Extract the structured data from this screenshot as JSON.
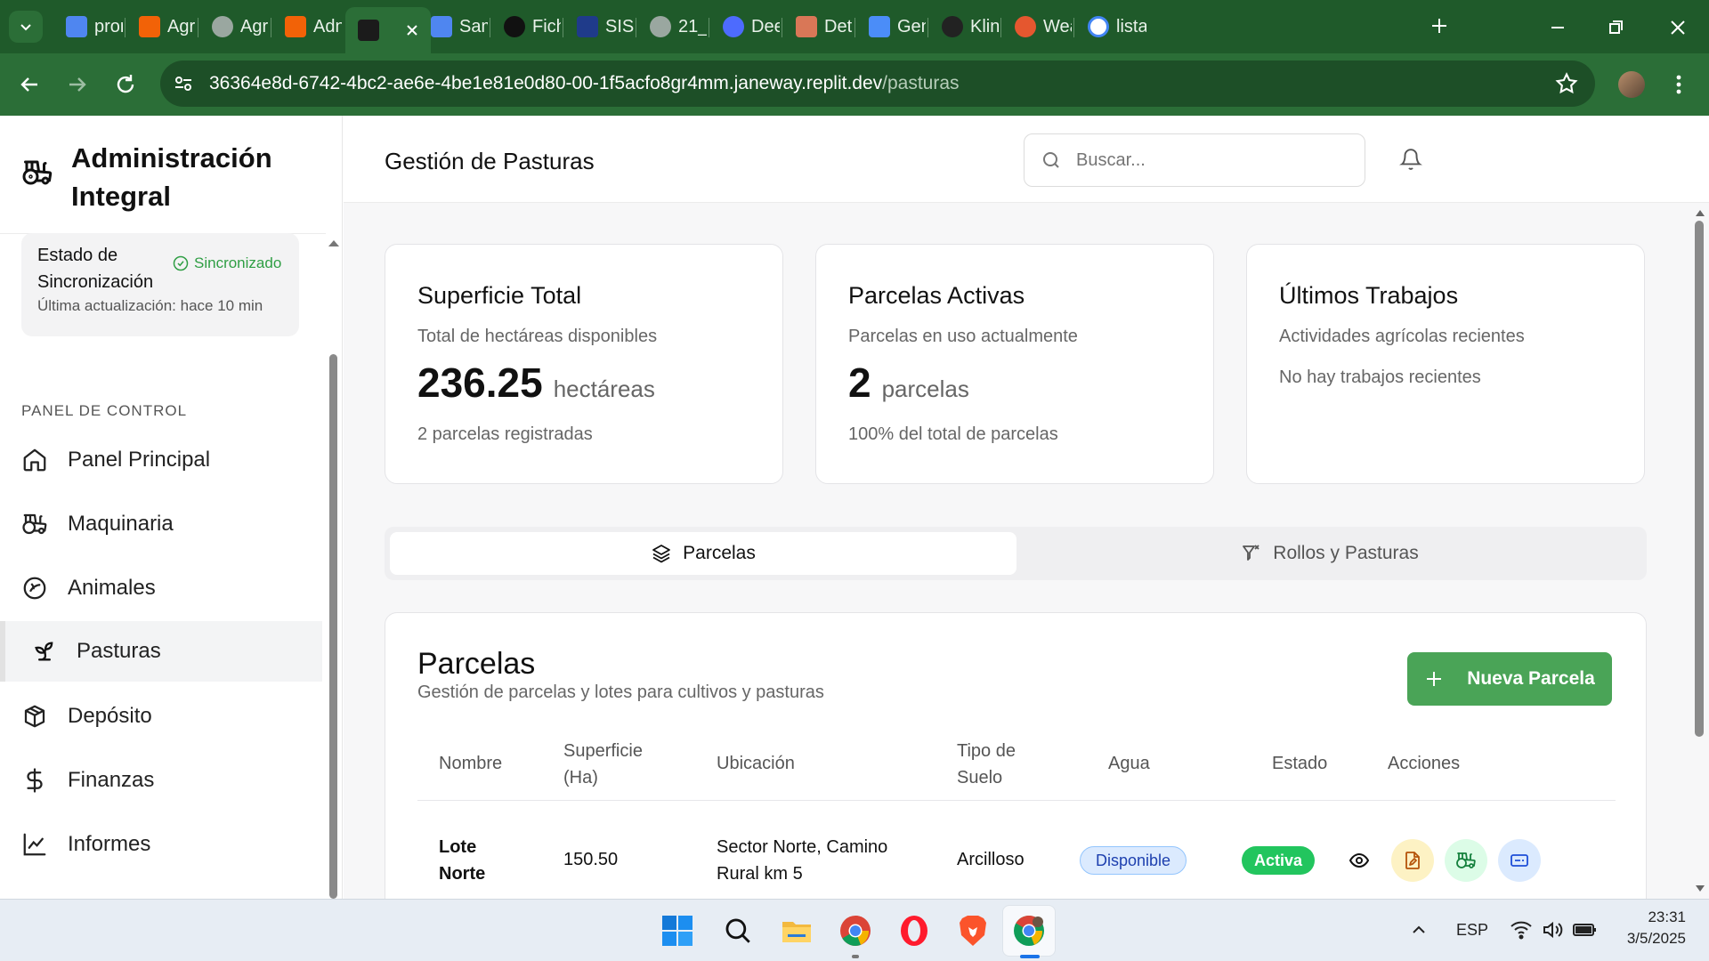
{
  "browser": {
    "tabs": [
      {
        "label": "pror",
        "icon": "docs-icon",
        "color": "#4f86f0"
      },
      {
        "label": "Agri",
        "icon": "replit-icon",
        "color": "#f26207"
      },
      {
        "label": "Agri",
        "icon": "globe-icon",
        "color": "#9aa7a0"
      },
      {
        "label": "Adn",
        "icon": "replit-icon",
        "color": "#f26207"
      },
      {
        "label": "",
        "icon": "terminal-icon",
        "color": "#1b1b1b"
      },
      {
        "label": "Sam",
        "icon": "docs-icon",
        "color": "#4f86f0"
      },
      {
        "label": "Fich",
        "icon": "openai-icon",
        "color": "#111111"
      },
      {
        "label": "SIST",
        "icon": "bolt-icon",
        "color": "#1f3b8a"
      },
      {
        "label": "21_",
        "icon": "globe-icon",
        "color": "#9aa7a0"
      },
      {
        "label": "Dee",
        "icon": "deepseek-icon",
        "color": "#4d6bfe"
      },
      {
        "label": "Det",
        "icon": "claude-icon",
        "color": "#d97757"
      },
      {
        "label": "Gen",
        "icon": "gemini-icon",
        "color": "#4b8df8"
      },
      {
        "label": "Klin",
        "icon": "kling-icon",
        "color": "#222222"
      },
      {
        "label": "Wea",
        "icon": "weather-icon",
        "color": "#e5572f"
      },
      {
        "label": "lista",
        "icon": "google-icon",
        "color": "#ffffff"
      }
    ],
    "url_host": "36364e8d-6742-4bc2-ae6e-4be1e81e0d80-00-1f5acfo8gr4mm.janeway.replit.dev",
    "url_path": "/pasturas",
    "accent": "#1f5a2a"
  },
  "sidebar": {
    "brand_title": "Administración Integral",
    "sync": {
      "title": "Estado de Sincronización",
      "status": "Sincronizado",
      "updated": "Última actualización: hace 10 min"
    },
    "section_label": "PANEL DE CONTROL",
    "items": [
      {
        "label": "Panel Principal",
        "icon": "home-icon"
      },
      {
        "label": "Maquinaria",
        "icon": "tractor-icon"
      },
      {
        "label": "Animales",
        "icon": "animal-icon"
      },
      {
        "label": "Pasturas",
        "icon": "sprout-icon"
      },
      {
        "label": "Depósito",
        "icon": "box-icon"
      },
      {
        "label": "Finanzas",
        "icon": "dollar-icon"
      },
      {
        "label": "Informes",
        "icon": "chart-line-icon"
      }
    ],
    "active_item": "Pasturas"
  },
  "header": {
    "title": "Gestión de Pasturas",
    "search_placeholder": "Buscar..."
  },
  "stats": [
    {
      "title": "Superficie Total",
      "subtitle": "Total de hectáreas disponibles",
      "value": "236.25",
      "unit": "hectáreas",
      "footer": "2 parcelas registradas"
    },
    {
      "title": "Parcelas Activas",
      "subtitle": "Parcelas en uso actualmente",
      "value": "2",
      "unit": "parcelas",
      "footer": "100% del total de parcelas"
    },
    {
      "title": "Últimos Trabajos",
      "subtitle": "Actividades agrícolas recientes",
      "empty": "No hay trabajos recientes"
    }
  ],
  "tabs": {
    "parcelas": "Parcelas",
    "rollos": "Rollos y Pasturas"
  },
  "table": {
    "title": "Parcelas",
    "subtitle": "Gestión de parcelas y lotes para cultivos y pasturas",
    "new_button": "Nueva Parcela",
    "headers": {
      "nombre": "Nombre",
      "superficie_1": "Superficie",
      "superficie_2": "(Ha)",
      "ubicacion": "Ubicación",
      "tipo_1": "Tipo de",
      "tipo_2": "Suelo",
      "agua": "Agua",
      "estado": "Estado",
      "acciones": "Acciones"
    },
    "rows": [
      {
        "nombre_1": "Lote",
        "nombre_2": "Norte",
        "superficie": "150.50",
        "ubicacion_1": "Sector Norte, Camino",
        "ubicacion_2": "Rural km 5",
        "tipo_suelo": "Arcilloso",
        "agua": "Disponible",
        "estado": "Activa"
      }
    ],
    "colors": {
      "primary": "#4aa457",
      "agua_bg": "#dbeafe",
      "agua_fg": "#1e40af",
      "estado_bg": "#22c55e"
    }
  },
  "taskbar": {
    "lang": "ESP",
    "time": "23:31",
    "date": "3/5/2025"
  }
}
